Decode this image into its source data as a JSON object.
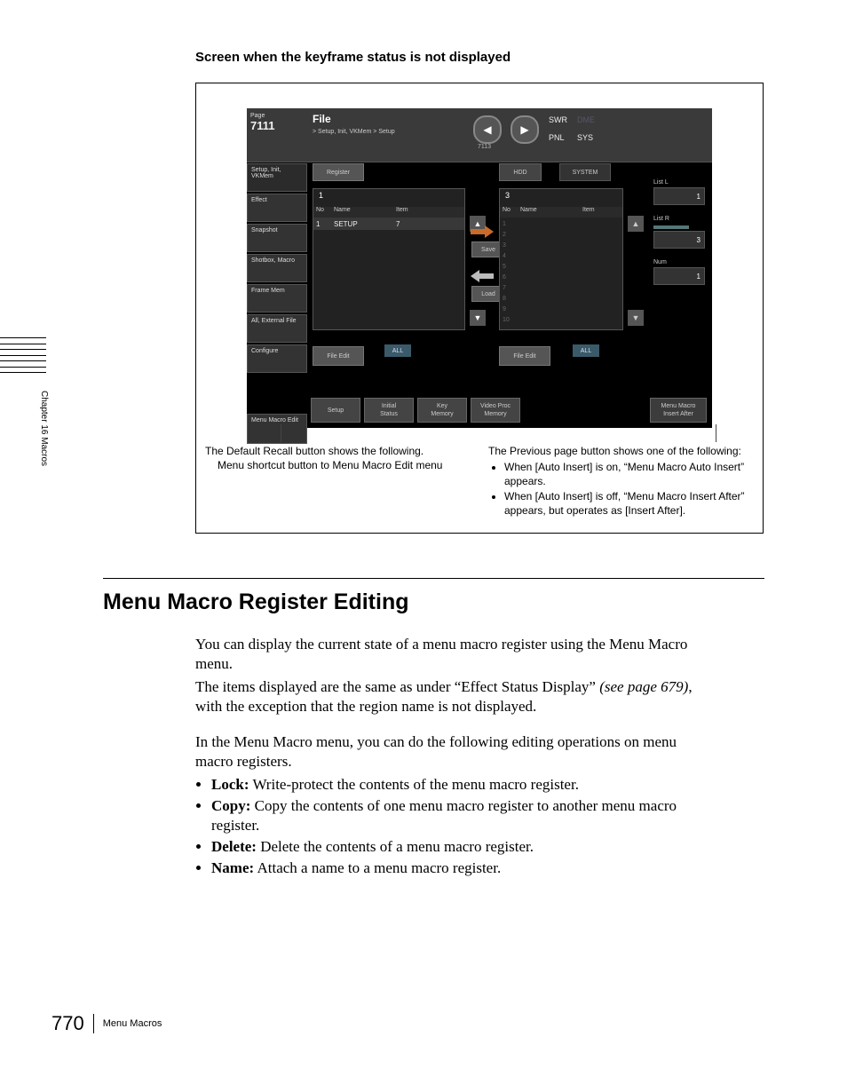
{
  "side_label": "Chapter 16  Macros",
  "sub_heading": "Screen when the keyframe status is not displayed",
  "screenshot": {
    "page_label": "Page",
    "page_num": "7111",
    "file_title": "File",
    "breadcrumb": "> Setup, Init, VKMem > Setup",
    "nav_prev_sub": "7113",
    "top": {
      "swr": "SWR",
      "dme": "DME",
      "pnl": "PNL",
      "sys": "SYS"
    },
    "leftnav": {
      "setup": "Setup, Init,\nVKMem",
      "effect": "Effect",
      "snapshot": "Snapshot",
      "shotbox": "Shotbox,\nMacro",
      "framemem": "Frame Mem",
      "allext": "All,\nExternal File",
      "configure": "Configure",
      "menumacro": "Menu\nMacro\nEdit"
    },
    "register": "Register",
    "hdd": "HDD",
    "system": "SYSTEM",
    "list1": {
      "col_num": "1",
      "head_no": "No",
      "head_name": "Name",
      "head_item": "Item",
      "row_no": "1",
      "row_name": "SETUP",
      "row_item": "7"
    },
    "list2": {
      "col_num": "3",
      "head_no": "No",
      "head_name": "Name",
      "head_item": "Item",
      "rows": "1\n2\n3\n4\n5\n6\n7\n8\n9\n10"
    },
    "save": "Save",
    "load": "Load",
    "file_edit": "File Edit",
    "all": "ALL",
    "right": {
      "listL_lbl": "List L",
      "listL_val": "1",
      "listR_lbl": "List R",
      "listR_val": "3",
      "num_lbl": "Num",
      "num_val": "1"
    },
    "bottom": {
      "setup": "Setup",
      "initial": "Initial\nStatus",
      "keymem": "Key\nMemory",
      "vpmem": "Video Proc\nMemory",
      "mminsert": "Menu Macro\nInsert After"
    }
  },
  "callouts": {
    "left_line1": "The Default Recall button shows the following.",
    "left_line2": "Menu shortcut button to Menu Macro Edit menu",
    "right_intro": "The Previous page button shows one of the following:",
    "right_b1": "When [Auto Insert] is on, “Menu Macro Auto Insert” appears.",
    "right_b2": "When [Auto Insert] is off, “Menu Macro Insert After” appears, but operates as [Insert After]."
  },
  "h1": "Menu Macro Register Editing",
  "body": {
    "p1": "You can display the current state of a menu macro register using the Menu Macro menu.",
    "p2a": "The items displayed are the same as under “Effect Status Display” ",
    "p2b": "(see page 679)",
    "p2c": ", with the exception that the region name is not displayed.",
    "p3": "In the Menu Macro menu, you can do the following editing operations on menu macro registers.",
    "li1b": "Lock:",
    "li1": " Write-protect the contents of the menu macro register.",
    "li2b": "Copy:",
    "li2": " Copy the contents of one menu macro register to another menu macro register.",
    "li3b": "Delete:",
    "li3": " Delete the contents of a menu macro register.",
    "li4b": "Name:",
    "li4": " Attach a name to a menu macro register."
  },
  "footer": {
    "page": "770",
    "text": "Menu Macros"
  }
}
